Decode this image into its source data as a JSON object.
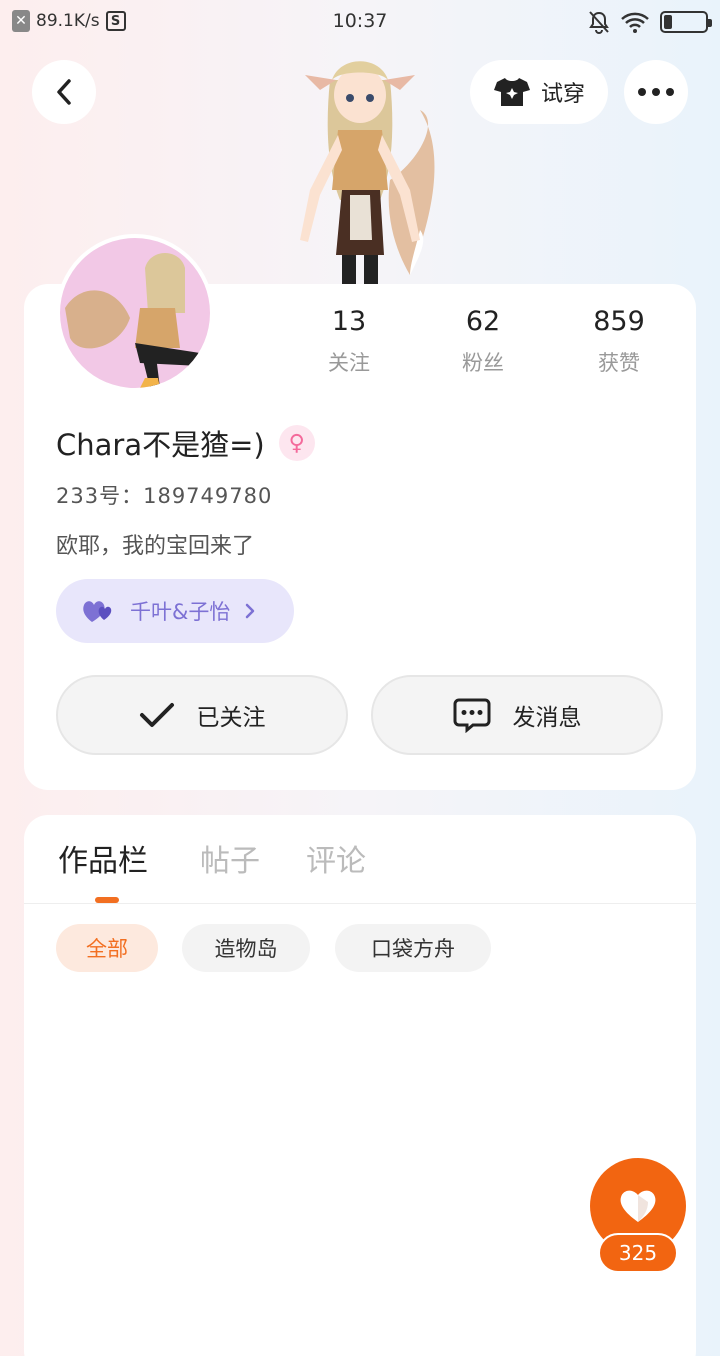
{
  "status_bar": {
    "network_speed": "89.1K/s",
    "time": "10:37",
    "battery_level": 0.2
  },
  "header": {
    "back_icon": "chevron-left-icon",
    "try_on_label": "试穿",
    "more_icon": "more-horizontal-icon"
  },
  "profile": {
    "stats": [
      {
        "value": "13",
        "label": "关注"
      },
      {
        "value": "62",
        "label": "粉丝"
      },
      {
        "value": "859",
        "label": "获赞"
      }
    ],
    "username": "Chara不是猹=)",
    "gender_icon": "female-icon",
    "uid_label": "233号：",
    "uid_value": "189749780",
    "bio": "欧耶，我的宝回来了",
    "couple_label": "千叶&子怡",
    "follow_button_label": "已关注",
    "message_button_label": "发消息"
  },
  "tabs": [
    {
      "label": "作品栏",
      "active": true
    },
    {
      "label": "帖子",
      "active": false
    },
    {
      "label": "评论",
      "active": false
    }
  ],
  "filter_chips": [
    {
      "label": "全部",
      "active": true
    },
    {
      "label": "造物岛",
      "active": false
    },
    {
      "label": "口袋方舟",
      "active": false
    }
  ],
  "like_fab": {
    "count": "325"
  },
  "colors": {
    "accent": "#f26511",
    "couple_purple": "#7d71d4",
    "female_pink": "#f46a9b"
  }
}
